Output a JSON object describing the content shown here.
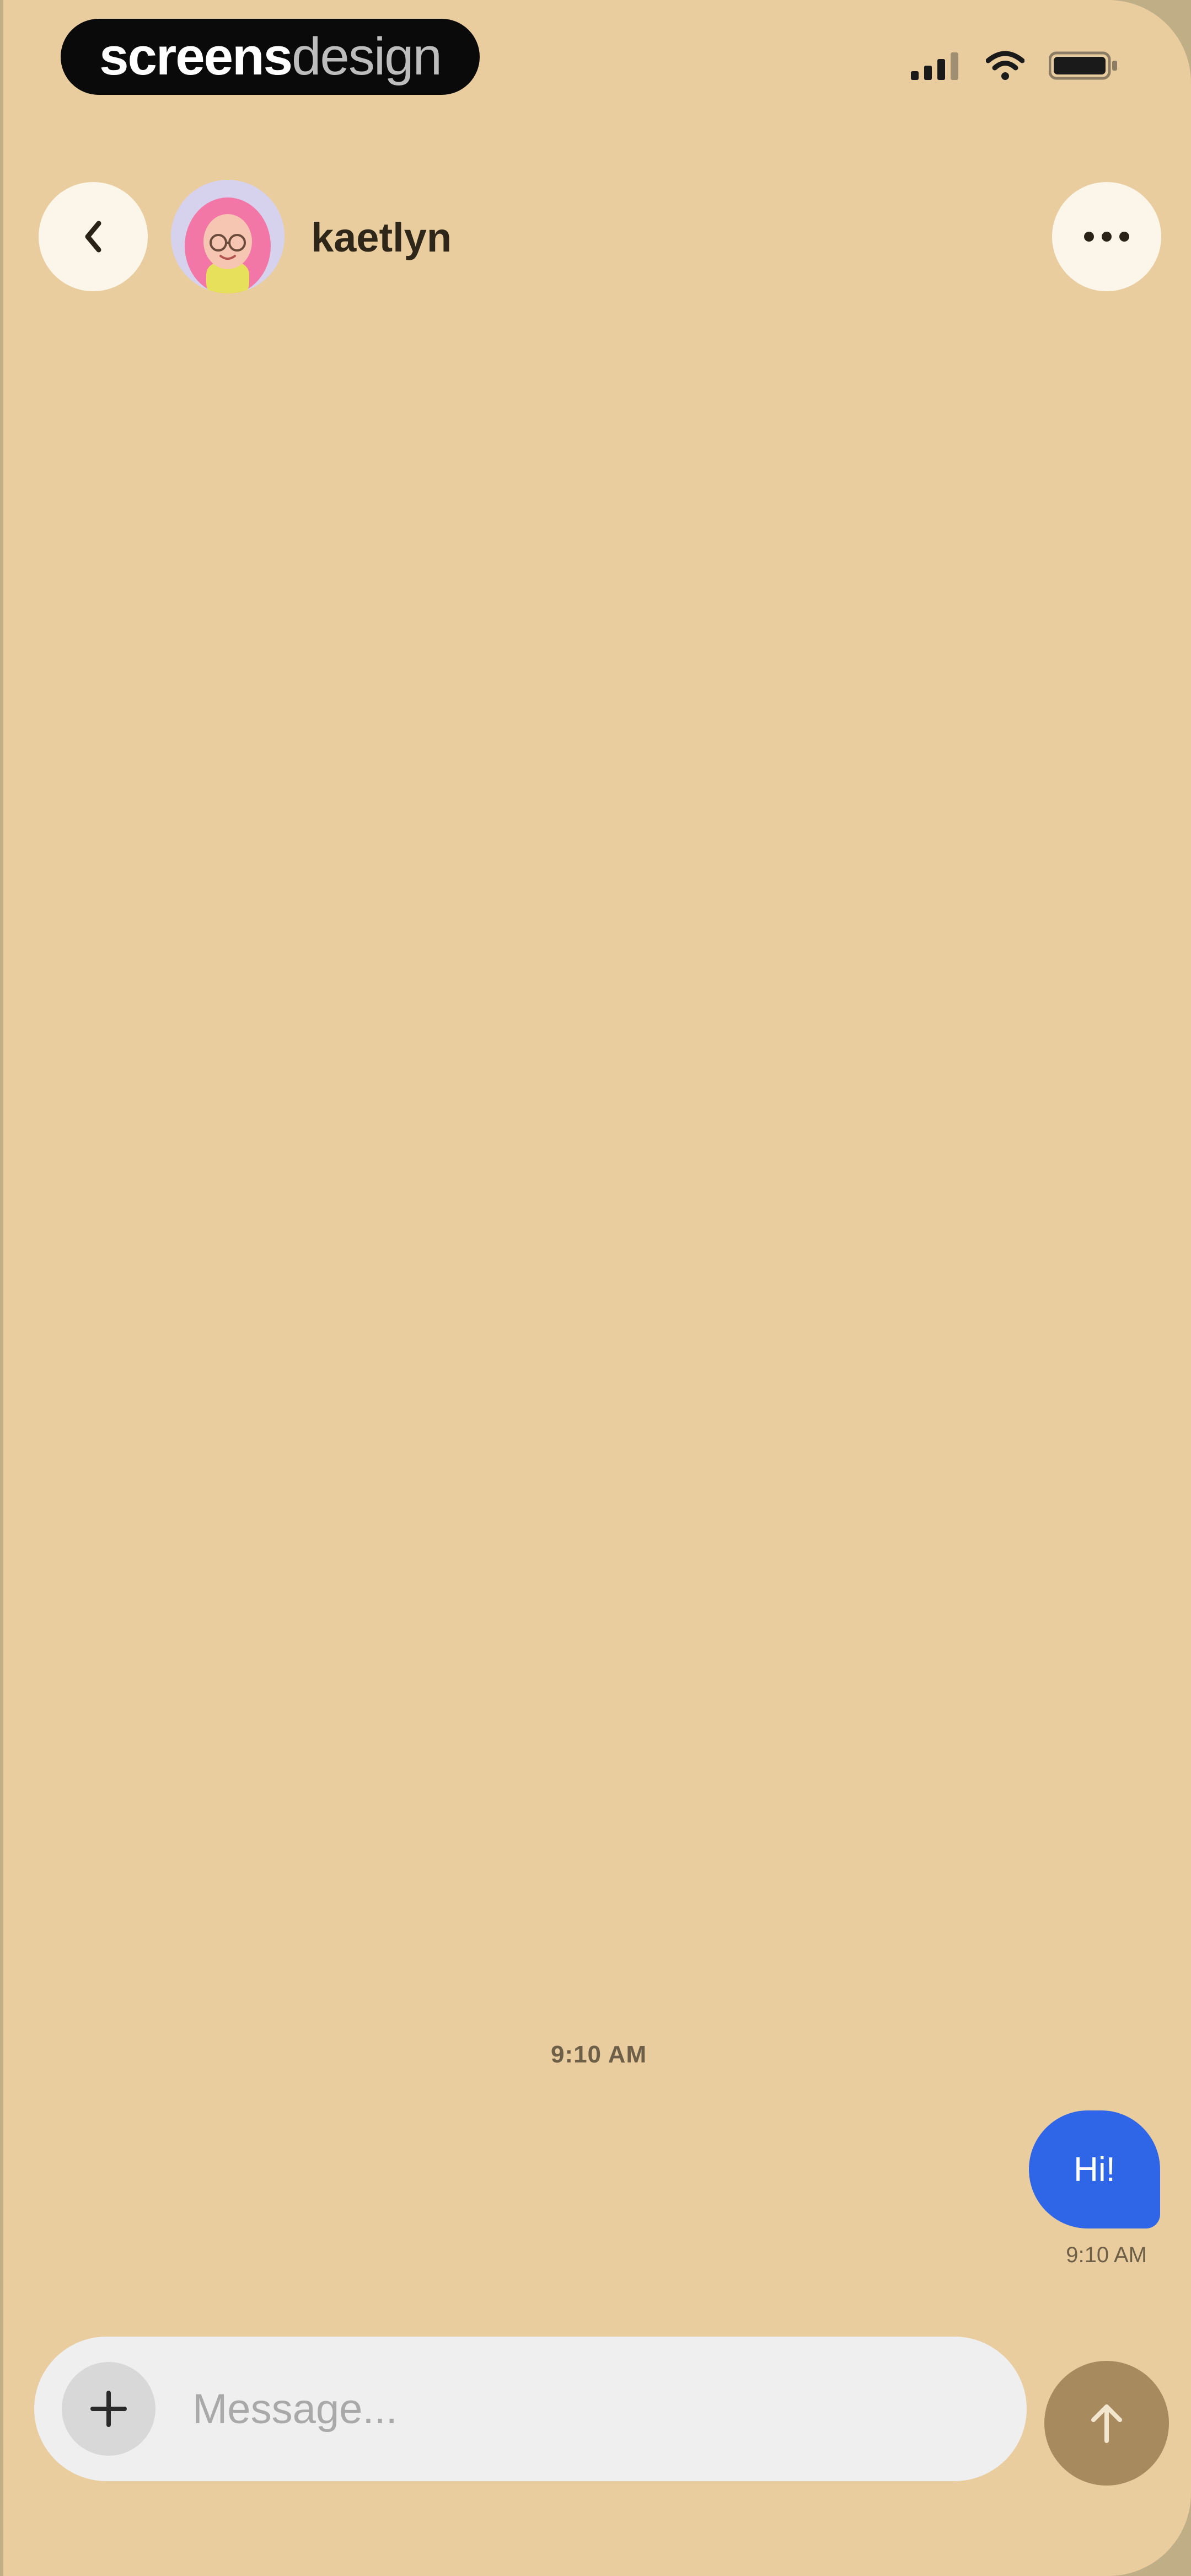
{
  "status_bar": {
    "brand_part_1": "screens",
    "brand_part_2": "design",
    "icons": [
      "cellular-signal-icon",
      "wifi-icon",
      "battery-icon"
    ]
  },
  "header": {
    "back_icon": "chevron-left-icon",
    "contact_name": "kaetlyn",
    "more_icon": "ellipsis-icon"
  },
  "conversation": {
    "time_divider": "9:10 AM",
    "messages": [
      {
        "sender": "me",
        "text": "Hi!",
        "time": "9:10 AM"
      }
    ]
  },
  "composer": {
    "add_icon": "plus-icon",
    "placeholder": "Message...",
    "value": "",
    "send_icon": "arrow-up-icon"
  },
  "colors": {
    "background": "#e9cd9f",
    "outgoing_bubble": "#2f66e8",
    "send_button": "#a88a5f",
    "header_button": "#fbf5ea",
    "composer": "#efefef"
  }
}
